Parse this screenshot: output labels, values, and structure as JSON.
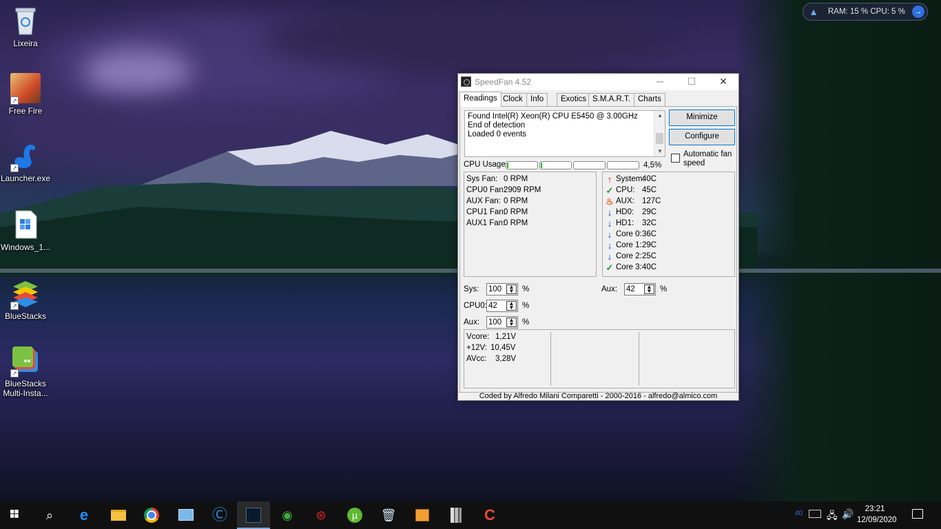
{
  "desktop": {
    "icons": [
      {
        "label": "Lixeira",
        "icon": "recycle-bin-icon"
      },
      {
        "label": "Free Fire",
        "icon": "free-fire-icon"
      },
      {
        "label": "Launcher.exe",
        "icon": "swan-launcher-icon"
      },
      {
        "label": "Windows_1...",
        "icon": "windows-file-icon"
      },
      {
        "label": "BlueStacks",
        "icon": "bluestacks-icon"
      },
      {
        "label": "BlueStacks",
        "label2": "Multi-Insta...",
        "icon": "bluestacks-multi-icon"
      }
    ]
  },
  "monitor_widget": {
    "text": "RAM: 15 %  CPU: 5 %"
  },
  "window": {
    "title": "SpeedFan 4.52",
    "tabs": [
      "Readings",
      "Clock",
      "Info",
      "Exotics",
      "S.M.A.R.T.",
      "Charts"
    ],
    "log": [
      "Found Intel(R) Xeon(R) CPU E5450 @ 3.00GHz",
      "End of detection",
      "Loaded 0 events"
    ],
    "buttons": {
      "minimize": "Minimize",
      "configure": "Configure"
    },
    "auto_fan_label": "Automatic fan speed",
    "cpu_usage_label": "CPU Usage",
    "cpu_usage_value": "4,5%",
    "cpu_core_fill_fraction": [
      0.04,
      0.04,
      0.0,
      0.0
    ],
    "fans": [
      {
        "name": "Sys Fan:",
        "value": "0 RPM"
      },
      {
        "name": "CPU0 Fan:",
        "value": "2909 RPM"
      },
      {
        "name": "AUX Fan:",
        "value": "0 RPM"
      },
      {
        "name": "CPU1 Fan:",
        "value": "0 RPM"
      },
      {
        "name": "AUX1 Fan:",
        "value": "0 RPM"
      }
    ],
    "temps": [
      {
        "name": "System:",
        "value": "40C",
        "status": "up"
      },
      {
        "name": "CPU:",
        "value": "45C",
        "status": "ok"
      },
      {
        "name": "AUX:",
        "value": "127C",
        "status": "hot"
      },
      {
        "name": "HD0:",
        "value": "29C",
        "status": "down"
      },
      {
        "name": "HD1:",
        "value": "32C",
        "status": "down"
      },
      {
        "name": "Core 0:",
        "value": "36C",
        "status": "down"
      },
      {
        "name": "Core 1:",
        "value": "29C",
        "status": "down"
      },
      {
        "name": "Core 2:",
        "value": "25C",
        "status": "down"
      },
      {
        "name": "Core 3:",
        "value": "40C",
        "status": "ok"
      }
    ],
    "speeds": [
      {
        "label": "Sys:",
        "value": "100"
      },
      {
        "label": "CPU0:",
        "value": "42"
      },
      {
        "label": "Aux:",
        "value": "100"
      },
      {
        "label": "Aux:",
        "value": "42"
      }
    ],
    "percent_sign": "%",
    "voltages": [
      {
        "name": "Vcore:",
        "value": "1,21V"
      },
      {
        "name": "+12V:",
        "value": "10,45V"
      },
      {
        "name": "AVcc:",
        "value": "3,28V"
      }
    ],
    "status_text": "Coded by Alfredo Milani Comparetti - 2000-2016 - alfredo@almico.com"
  },
  "taskbar": {
    "items": [
      "start",
      "search",
      "edge",
      "file-explorer",
      "chrome",
      "control-panel",
      "ccleaner",
      "speedfan",
      "network-app",
      "antivirus",
      "utorrent",
      "recycle-tool",
      "package-app",
      "sticks-app",
      "ccleaner-red"
    ],
    "clock_time": "23:21",
    "clock_date": "12/09/2020",
    "tray_badge": "40"
  }
}
